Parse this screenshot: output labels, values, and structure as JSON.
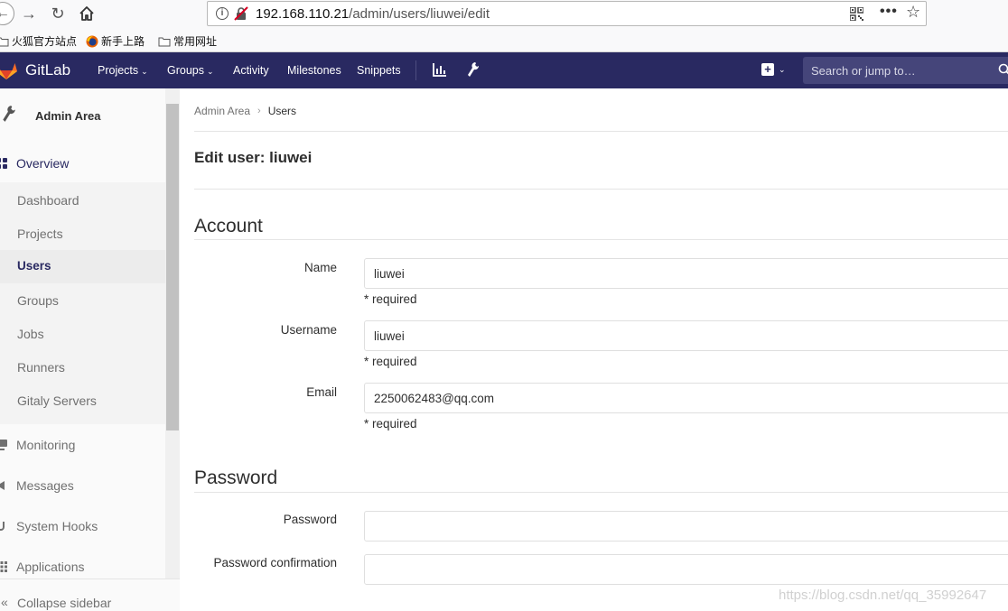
{
  "browser": {
    "url_host": "192.168.110.21",
    "url_path": "/admin/users/liuwei/edit",
    "bookmarks": [
      {
        "label": "火狐官方站点"
      },
      {
        "label": "新手上路"
      },
      {
        "label": "常用网址"
      }
    ]
  },
  "header": {
    "brand": "GitLab",
    "nav": [
      {
        "label": "Projects",
        "dropdown": true
      },
      {
        "label": "Groups",
        "dropdown": true
      },
      {
        "label": "Activity"
      },
      {
        "label": "Milestones"
      },
      {
        "label": "Snippets"
      }
    ],
    "search_placeholder": "Search or jump to…",
    "colors": {
      "header_bg": "#292961",
      "search_bg": "#45457a"
    }
  },
  "sidebar": {
    "title": "Admin Area",
    "overview": "Overview",
    "items": [
      {
        "label": "Dashboard"
      },
      {
        "label": "Projects"
      },
      {
        "label": "Users",
        "active": true
      },
      {
        "label": "Groups"
      },
      {
        "label": "Jobs"
      },
      {
        "label": "Runners"
      },
      {
        "label": "Gitaly Servers"
      }
    ],
    "top_items": [
      {
        "label": "Monitoring"
      },
      {
        "label": "Messages"
      },
      {
        "label": "System Hooks"
      },
      {
        "label": "Applications"
      }
    ],
    "collapse": "Collapse sidebar"
  },
  "breadcrumb": {
    "root": "Admin Area",
    "sep": "›",
    "current": "Users"
  },
  "page": {
    "title": "Edit user: liuwei",
    "account": {
      "heading": "Account",
      "name_label": "Name",
      "name_value": "liuwei",
      "username_label": "Username",
      "username_value": "liuwei",
      "email_label": "Email",
      "email_value": "2250062483@qq.com",
      "required": "* required"
    },
    "password": {
      "heading": "Password",
      "password_label": "Password",
      "confirm_label": "Password confirmation"
    }
  },
  "watermark": "https://blog.csdn.net/qq_35992647"
}
